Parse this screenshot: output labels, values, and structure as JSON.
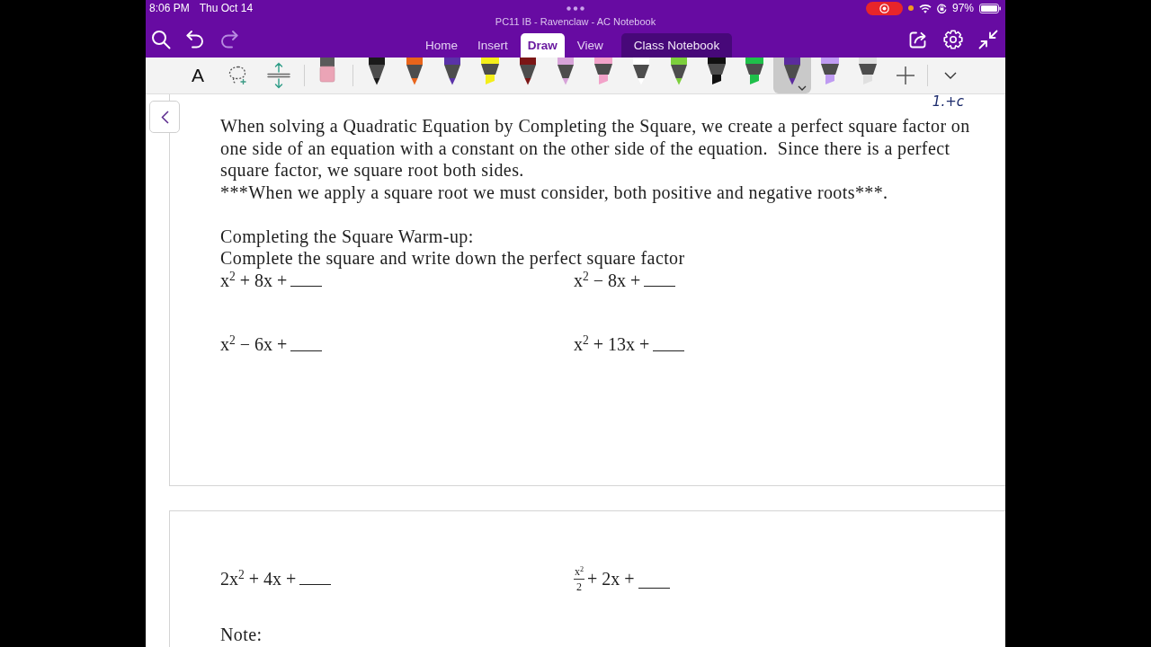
{
  "status_bar": {
    "time": "8:06 PM",
    "date": "Thu Oct 14",
    "battery": "97%"
  },
  "window": {
    "title": "PC11 IB - Ravenclaw - AC Notebook"
  },
  "actions": [
    {
      "kind": "search",
      "disabled": false
    },
    {
      "kind": "undo",
      "disabled": false
    },
    {
      "kind": "redo",
      "disabled": true
    }
  ],
  "tabs": [
    {
      "label": "Home",
      "kind": "standard",
      "selected": false
    },
    {
      "label": "Insert",
      "kind": "standard",
      "selected": false
    },
    {
      "label": "Draw",
      "kind": "standard",
      "selected": true
    },
    {
      "label": "View",
      "kind": "standard",
      "selected": false
    },
    {
      "label": "Class Notebook",
      "kind": "addin",
      "selected": false
    }
  ],
  "right_actions": [
    {
      "kind": "share"
    },
    {
      "kind": "settings"
    },
    {
      "kind": "collapse"
    }
  ],
  "draw_tools": [
    {
      "kind": "text",
      "label": "A"
    },
    {
      "kind": "lasso"
    },
    {
      "kind": "space"
    },
    {
      "kind": "divider"
    },
    {
      "kind": "eraser"
    },
    {
      "kind": "divider"
    }
  ],
  "pens": [
    {
      "kind": "pen",
      "color": "#1a1a1a",
      "selected": false
    },
    {
      "kind": "pen",
      "color": "#e8641b",
      "selected": false
    },
    {
      "kind": "pen",
      "color": "#5a32a8",
      "selected": false
    },
    {
      "kind": "highlighter",
      "color": "#f4ee1a",
      "selected": false
    },
    {
      "kind": "pen",
      "color": "#7b1616",
      "selected": false
    },
    {
      "kind": "pen",
      "color": "#d7a3d9",
      "selected": false
    },
    {
      "kind": "highlighter",
      "color": "#f2a2c9",
      "selected": false
    },
    {
      "kind": "pen",
      "color": "#ffffff",
      "selected": false
    },
    {
      "kind": "pen",
      "color": "#7ccf3c",
      "selected": false
    },
    {
      "kind": "highlighter",
      "color": "#111111",
      "selected": false
    },
    {
      "kind": "highlighter",
      "color": "#1fbf4a",
      "selected": false
    },
    {
      "kind": "pen",
      "color": "#5b2b9e",
      "selected": true
    },
    {
      "kind": "highlighter",
      "color": "#bf9bf2",
      "selected": false
    },
    {
      "kind": "highlighter",
      "color": "#e0e0e0",
      "selected": false
    }
  ],
  "page": {
    "ink_note": "1.+c",
    "paragraphs": [
      "When solving a Quadratic Equation by Completing the Square, we create a perfect square factor on one side of an equation with a constant on the other side of the equation.  Since there is a perfect square factor, we square root both sides.",
      "***When we apply a square root we must consider, both positive and negative roots***."
    ],
    "heading": "Completing the Square Warm-up:",
    "instruction": "Complete the square and write down the perfect square factor",
    "problems": [
      {
        "kind": "expression",
        "expression": "x$^{2}$ + 8x +"
      },
      {
        "kind": "expression",
        "expression": "x$^{2}$ − 8x +"
      },
      {
        "kind": "expression",
        "expression": "x$^{2}$ − 6x +"
      },
      {
        "kind": "expression",
        "expression": "x$^{2}$ + 13x +"
      }
    ]
  },
  "page_2": {
    "problems": [
      {
        "kind": "expression",
        "expression": "2x$^{2}$ + 4x +"
      },
      {
        "kind": "fraction",
        "numerator": "x$^{2}$",
        "denominator": "2",
        "expression": "+ 2x +"
      }
    ],
    "note": "Note:"
  }
}
